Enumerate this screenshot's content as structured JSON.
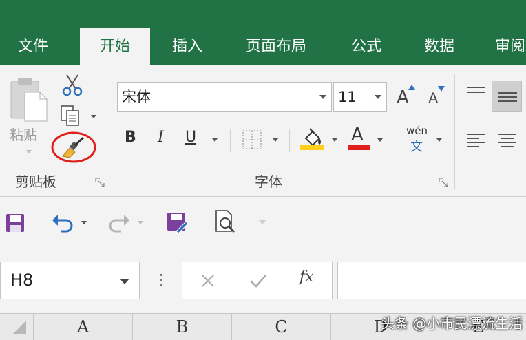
{
  "tabs": [
    {
      "label": "文件",
      "active": false
    },
    {
      "label": "开始",
      "active": true
    },
    {
      "label": "插入",
      "active": false
    },
    {
      "label": "页面布局",
      "active": false
    },
    {
      "label": "公式",
      "active": false
    },
    {
      "label": "数据",
      "active": false
    },
    {
      "label": "审阅",
      "active": false
    }
  ],
  "clipboard": {
    "paste_label": "粘贴",
    "group_label": "剪贴板",
    "format_painter_icon": "paintbrush-icon",
    "highlight_color": "#e0201b"
  },
  "font": {
    "font_name": "宋体",
    "font_size": "11",
    "bold": "B",
    "italic": "I",
    "underline": "U",
    "font_color_letter": "A",
    "grow_letter": "A",
    "shrink_letter": "A",
    "phonetic_top": "wén",
    "phonetic_bottom": "文",
    "group_label": "字体",
    "fill_color": "#ffd11a",
    "font_color": "#e0201b"
  },
  "name_box": {
    "value": "H8"
  },
  "formula": {
    "fx_label": "fx"
  },
  "columns": [
    "A",
    "B",
    "C",
    "D",
    "E"
  ],
  "watermark": "头条 @小市民漂流生活",
  "colors": {
    "brand": "#217346",
    "accent_purple": "#7b3f9e",
    "accent_blue": "#2e6fbd"
  }
}
